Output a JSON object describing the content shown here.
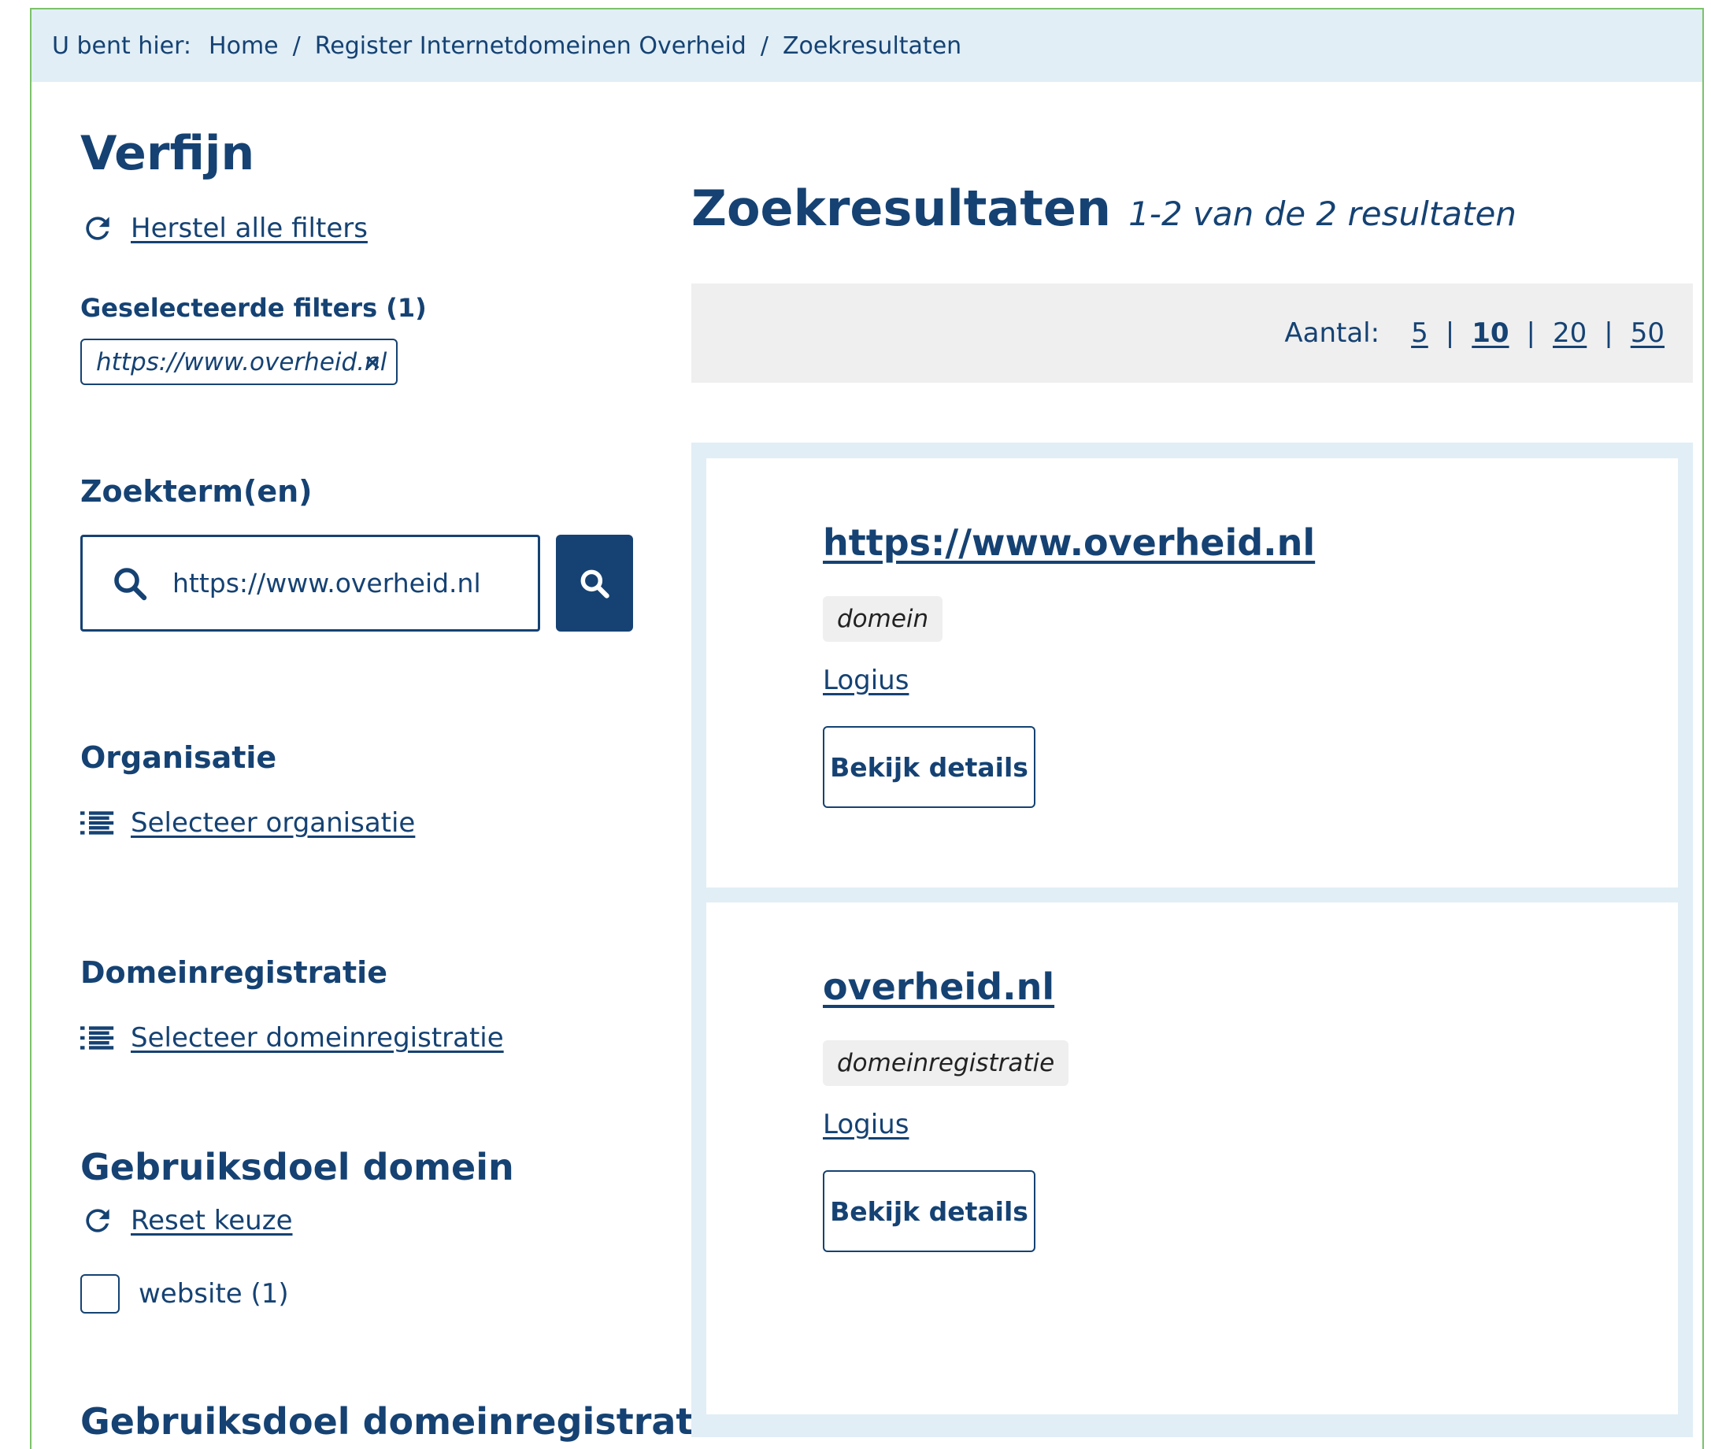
{
  "breadcrumb": {
    "lead": "U bent hier:",
    "items": [
      "Home",
      "Register Internetdomeinen Overheid",
      "Zoekresultaten"
    ],
    "separator": "/"
  },
  "sidebar": {
    "title": "Verfijn",
    "reset_all": "Herstel alle filters",
    "selected_filters_title": "Geselecteerde filters (1)",
    "selected_filters": [
      {
        "label": "https://www.overheid.nl",
        "remove": "×"
      }
    ],
    "search": {
      "title": "Zoekterm(en)",
      "value": "https://www.overheid.nl"
    },
    "organisatie": {
      "title": "Organisatie",
      "link": "Selecteer organisatie"
    },
    "domeinregistratie": {
      "title": "Domeinregistratie",
      "link": "Selecteer domeinregistratie"
    },
    "gebruiksdoel_domein": {
      "title": "Gebruiksdoel domein",
      "reset": "Reset keuze",
      "options": [
        {
          "label": "website (1)",
          "checked": false
        }
      ]
    },
    "gebruiksdoel_domeinregistratie": {
      "title": "Gebruiksdoel domeinregistratie"
    }
  },
  "main": {
    "title": "Zoekresultaten",
    "count": "1-2 van de 2 resultaten",
    "pager": {
      "label": "Aantal:",
      "options": [
        "5",
        "10",
        "20",
        "50"
      ],
      "active": "10",
      "separator": "|"
    },
    "results": [
      {
        "title": "https://www.overheid.nl",
        "tag": "domein",
        "org": "Logius",
        "button": "Bekijk details"
      },
      {
        "title": "overheid.nl",
        "tag": "domeinregistratie",
        "org": "Logius",
        "button": "Bekijk details"
      }
    ]
  },
  "colors": {
    "brand": "#154273",
    "breadcrumb_bg": "#e1eef6",
    "results_bg": "#e1eef6",
    "pager_bg": "#efefef",
    "frame": "#7cc26a"
  },
  "icons": {
    "reset": "refresh-icon",
    "search": "search-icon",
    "list": "list-icon",
    "remove": "close-icon"
  }
}
